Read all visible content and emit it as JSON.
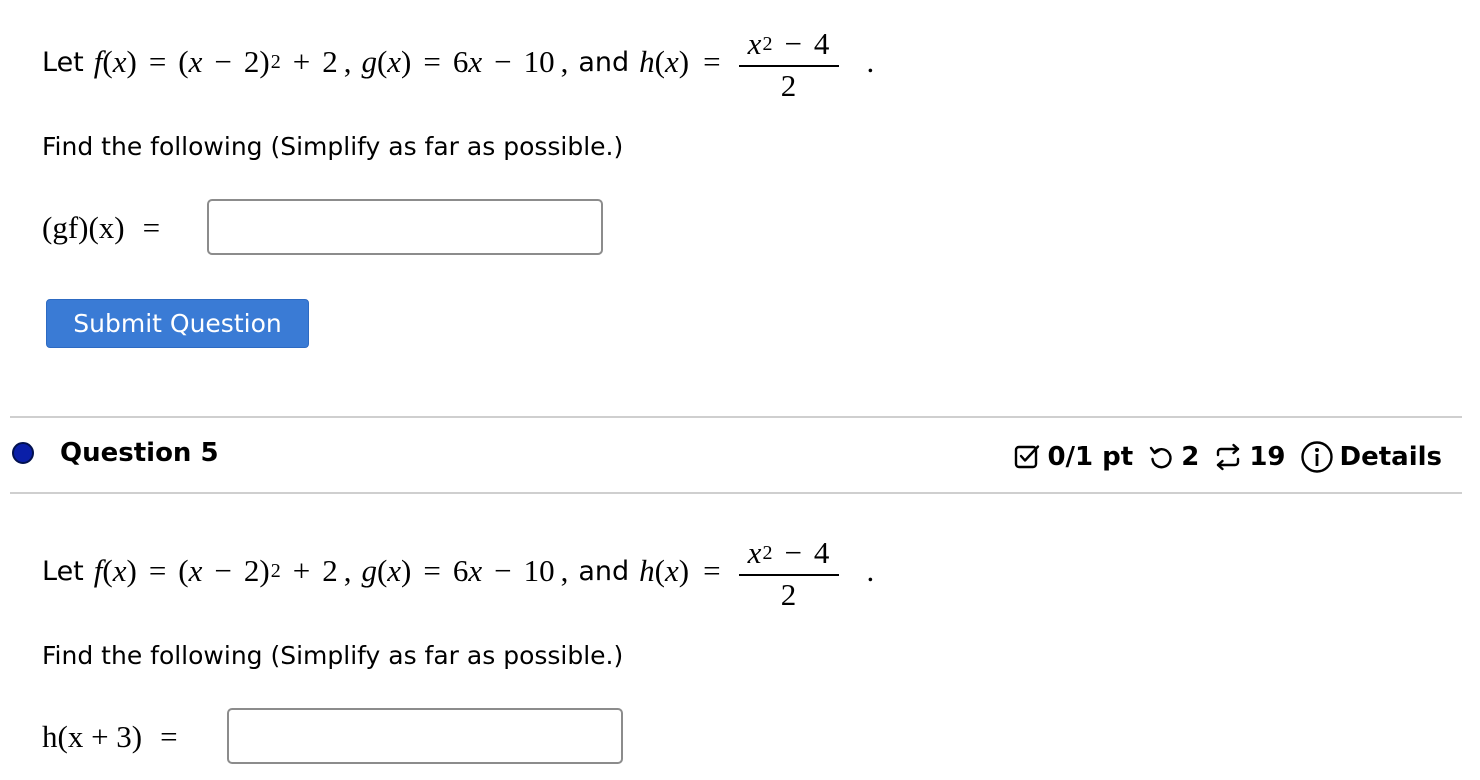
{
  "problem": {
    "let_word": "Let",
    "f_def": {
      "name": "f",
      "var": "x",
      "base": "x",
      "minus": "−",
      "two": "2",
      "exp": "2",
      "plus": "+",
      "const": "2"
    },
    "sep": ",",
    "g_def": {
      "name": "g",
      "var": "x",
      "coef": "6",
      "minus": "−",
      "const": "10"
    },
    "and_word": "and",
    "h_def": {
      "name": "h",
      "var": "x",
      "num_var": "x",
      "num_exp": "2",
      "num_minus": "−",
      "num_const": "4",
      "den": "2"
    },
    "period": "."
  },
  "instruction": "Find the following (Simplify as far as possible.)",
  "question4": {
    "answer": {
      "lhs": "(gf)(x)",
      "equals": "=",
      "value": "",
      "placeholder": ""
    },
    "submit_label": "Submit Question"
  },
  "question5": {
    "title": "Question 5",
    "meta": {
      "score": "0/1 pt",
      "retries": "2",
      "attempts": "19",
      "details": "Details",
      "icons": {
        "score": "checkbox-icon",
        "retries": "retry-icon",
        "attempts": "submissions-icon",
        "details": "info-icon"
      }
    },
    "answer": {
      "lhs": "h(x + 3)",
      "equals": "=",
      "value": "",
      "placeholder": ""
    }
  },
  "colors": {
    "accent": "#3a7bd5",
    "status_dot": "#0a1fa8",
    "divider": "#cfcfcf",
    "input_border": "#8c8c8c"
  }
}
